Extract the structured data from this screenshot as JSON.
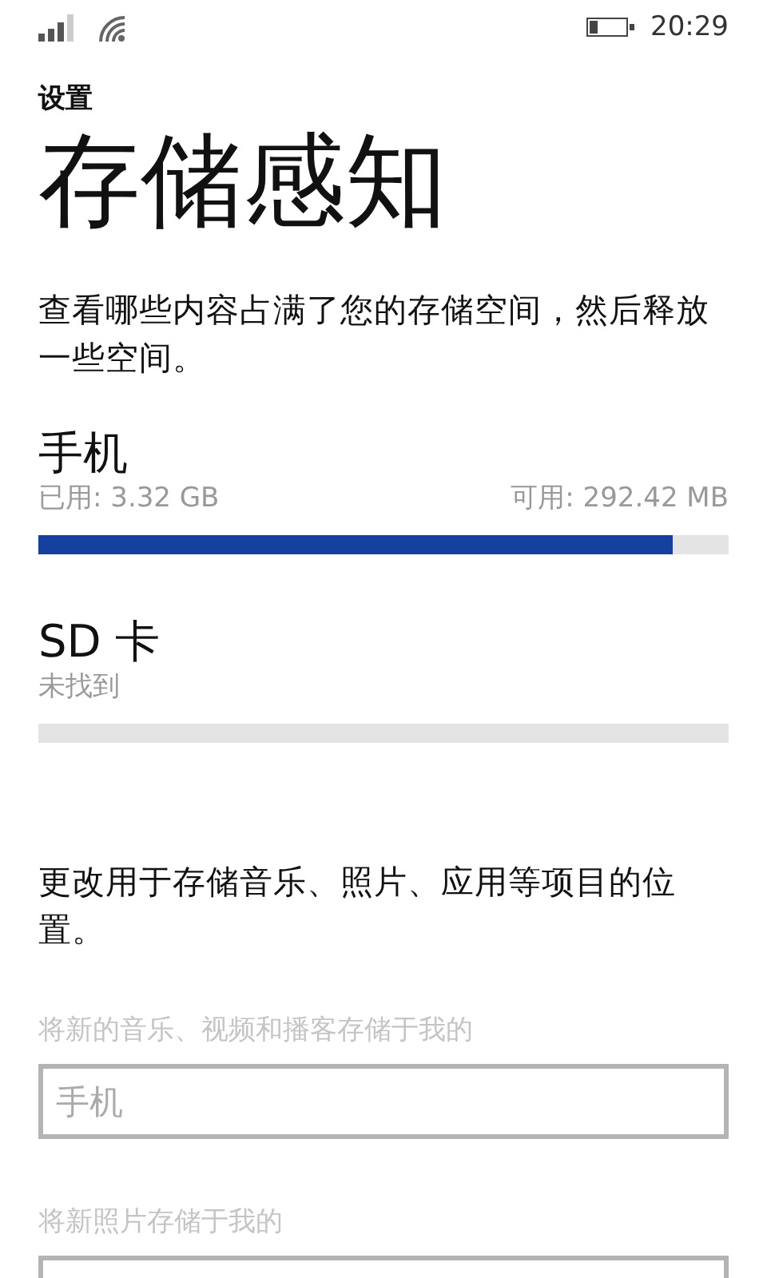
{
  "status_bar": {
    "time": "20:29"
  },
  "header": {
    "section": "设置",
    "title": "存储感知"
  },
  "description": "查看哪些内容占满了您的存储空间，然后释放一些空间。",
  "storages": [
    {
      "name": "手机",
      "used": "已用: 3.32 GB",
      "free": "可用: 292.42 MB",
      "level": 0.92
    },
    {
      "name": "SD 卡",
      "status": "未找到"
    }
  ],
  "locations_note": "更改用于存储音乐、照片、应用等项目的位置。",
  "pickers": [
    {
      "label": "将新的音乐、视频和播客存储于我的",
      "value": "手机",
      "disabled": true
    },
    {
      "label": "将新照片存储于我的",
      "disabled": true
    }
  ]
}
